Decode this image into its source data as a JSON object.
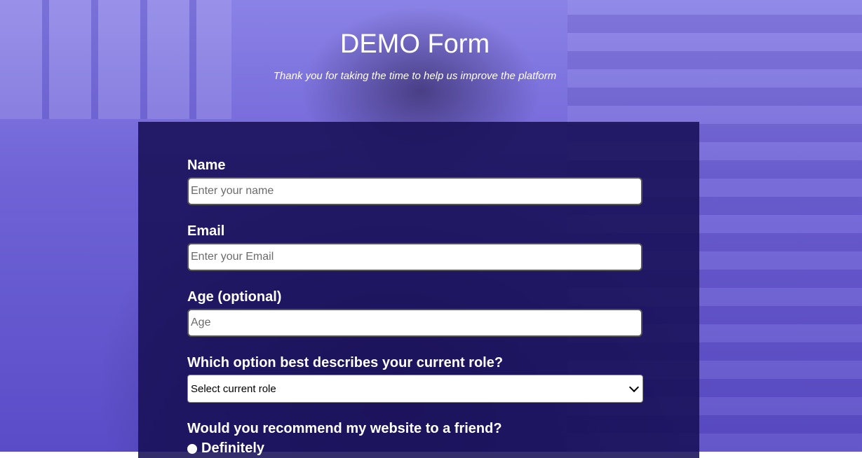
{
  "header": {
    "title": "DEMO Form",
    "subtitle": "Thank you for taking the time to help us improve the platform"
  },
  "form": {
    "name": {
      "label": "Name",
      "placeholder": "Enter your name",
      "value": ""
    },
    "email": {
      "label": "Email",
      "placeholder": "Enter your Email",
      "value": ""
    },
    "age": {
      "label": "Age (optional)",
      "placeholder": "Age",
      "value": ""
    },
    "role": {
      "label": "Which option best describes your current role?",
      "selected": "Select current role"
    },
    "recommend": {
      "label": "Would you recommend my website to a friend?",
      "options": [
        "Definitely"
      ]
    }
  },
  "icons": {
    "select_arrow": "chevron-down-icon",
    "radio": "radio-button-icon"
  }
}
